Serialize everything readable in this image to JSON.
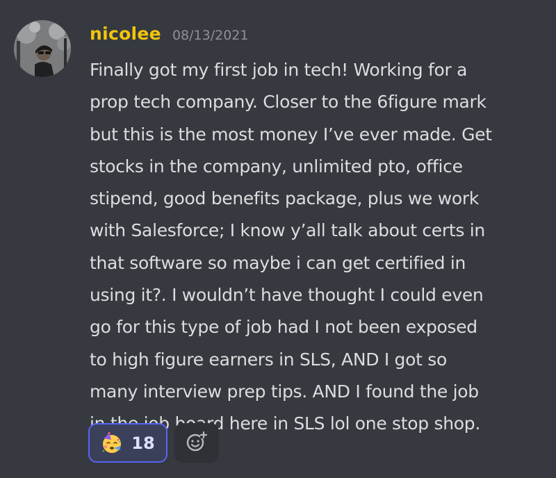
{
  "message": {
    "username": "nicolee",
    "timestamp": "08/13/2021",
    "text": "Finally got my first job in tech! Working for a\nprop tech company. Closer to the 6figure mark\nbut this is the most money I’ve ever made. Get\nstocks in the company, unlimited pto, office\nstipend, good benefits package, plus we work\nwith Salesforce; I know y’all talk about certs in\nthat software so maybe i can get certified in\nusing it?. I wouldn’t have thought I could even\ngo for this type of job had I not been exposed\nto high figure earners in SLS, AND I got so\nmany interview prep tips. AND I found the job\nin the job board here in SLS lol one stop shop.",
    "username_color": "#f1c40f"
  },
  "reactions": [
    {
      "emoji": "partying-face-icon",
      "count": "18",
      "active": true
    }
  ],
  "add_reaction": {
    "icon": "add-reaction-icon"
  },
  "colors": {
    "background": "#36393f",
    "text": "#dcddde",
    "timestamp": "#8e9297",
    "reaction_active_border": "#5865f2",
    "reaction_active_bg": "#3b405a"
  }
}
